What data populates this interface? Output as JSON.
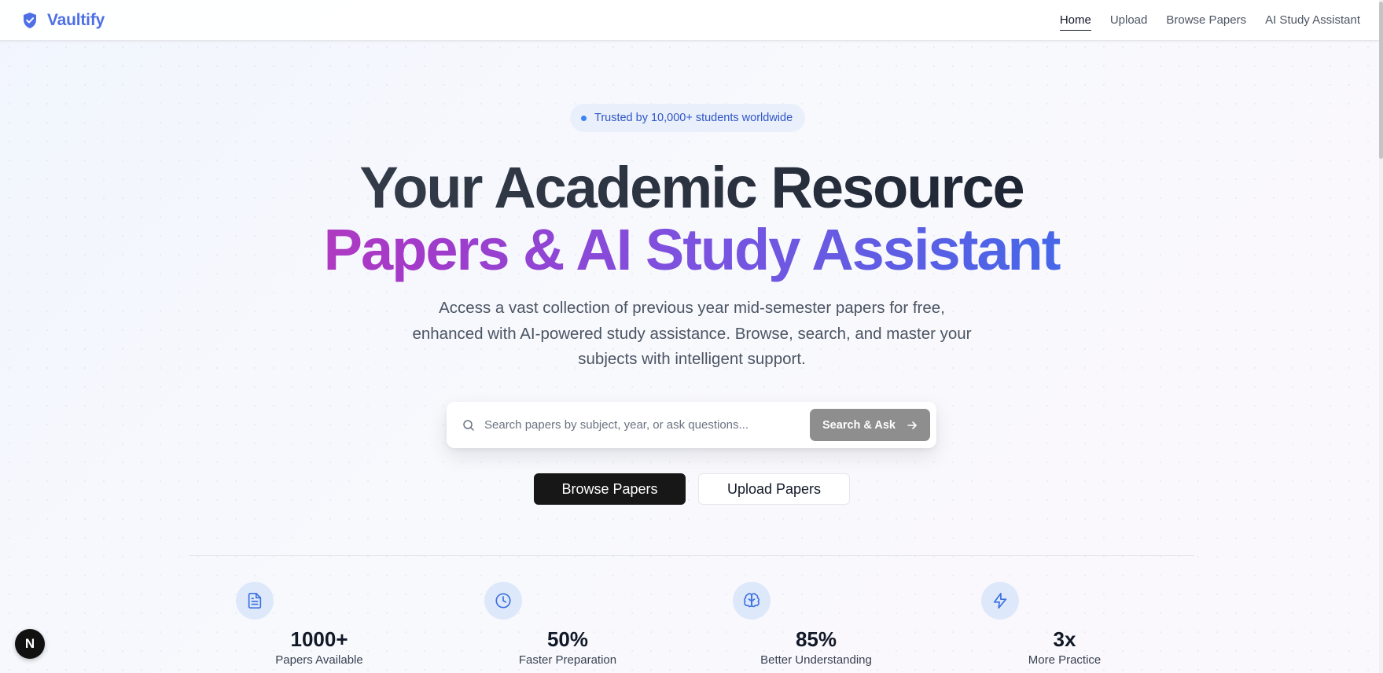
{
  "brand": {
    "name": "Vaultify",
    "logo_icon": "shield-check-icon",
    "color": "#4f6fe6"
  },
  "nav": {
    "items": [
      {
        "label": "Home",
        "active": true
      },
      {
        "label": "Upload",
        "active": false
      },
      {
        "label": "Browse Papers",
        "active": false
      },
      {
        "label": "AI Study Assistant",
        "active": false
      }
    ]
  },
  "hero": {
    "badge": "Trusted by 10,000+ students worldwide",
    "headline_line1": "Your Academic Resource",
    "headline_line2": "Papers & AI Study Assistant",
    "subtitle": "Access a vast collection of previous year mid-semester papers for free, enhanced with AI-powered study assistance. Browse, search, and master your subjects with intelligent support."
  },
  "search": {
    "placeholder": "Search papers by subject, year, or ask questions...",
    "value": "",
    "button_label": "Search & Ask",
    "icon": "search-icon",
    "button_icon": "arrow-right-icon"
  },
  "actions": {
    "primary_label": "Browse Papers",
    "secondary_label": "Upload Papers"
  },
  "stats": [
    {
      "icon": "file-text-icon",
      "value": "1000+",
      "label": "Papers Available"
    },
    {
      "icon": "clock-icon",
      "value": "50%",
      "label": "Faster Preparation"
    },
    {
      "icon": "brain-icon",
      "value": "85%",
      "label": "Better Understanding"
    },
    {
      "icon": "zap-icon",
      "value": "3x",
      "label": "More Practice"
    }
  ],
  "dev_badge": {
    "letter": "N"
  },
  "colors": {
    "accent_blue": "#3b82f6",
    "gradient_pink": "#db3aa7",
    "gradient_purple": "#7c52e0",
    "gradient_blue": "#1d7cf2",
    "primary_button": "#171717",
    "search_button": "#8e8e8e"
  }
}
